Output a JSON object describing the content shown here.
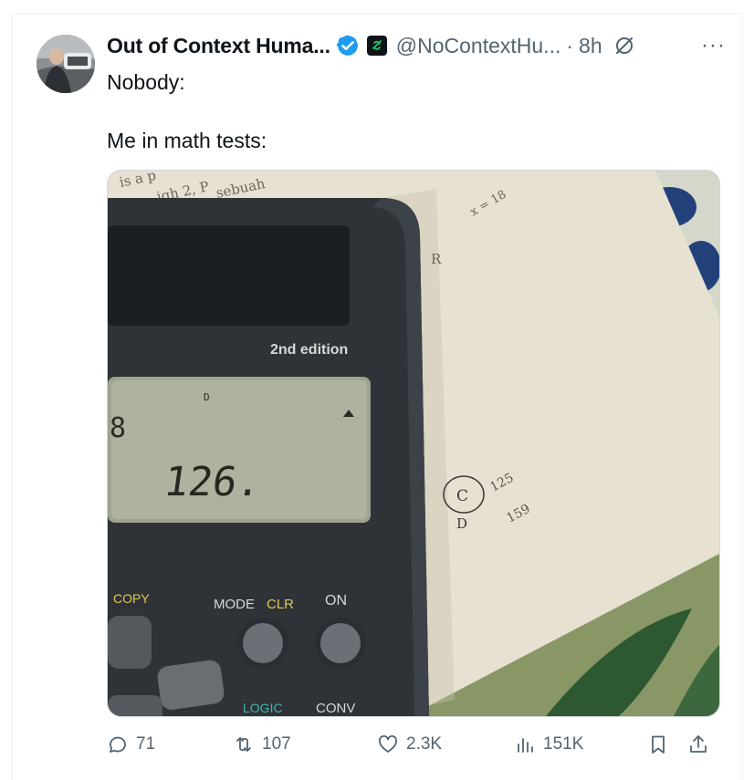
{
  "tweet": {
    "display_name": "Out of Context Huma...",
    "handle": "@NoContextHu...",
    "separator": "·",
    "time": "8h",
    "more_label": "···",
    "text": "Nobody:\n\nMe in math tests:"
  },
  "media": {
    "screen_small_digit": "8",
    "display_value": "126.",
    "model_label": "2nd edition",
    "indicator": "D",
    "key_copy": "COPY",
    "key_mode": "MODE",
    "key_clr": "CLR",
    "key_on": "ON",
    "key_logic": "LOGIC",
    "key_conv": "CONV",
    "paper_text_1": "is a p",
    "paper_text_2": "igh 2, P",
    "paper_text_3": "sebuah",
    "paper_text_4": "x = 18",
    "paper_text_5": "R",
    "option_c": "C",
    "option_c_value": "125",
    "option_d": "D",
    "option_d_value": "159"
  },
  "actions": {
    "replies": "71",
    "reposts": "107",
    "likes": "2.3K",
    "views": "151K"
  },
  "colors": {
    "verified_blue": "#1d9bf0",
    "muted_text": "#536471",
    "text": "#0f1419"
  }
}
